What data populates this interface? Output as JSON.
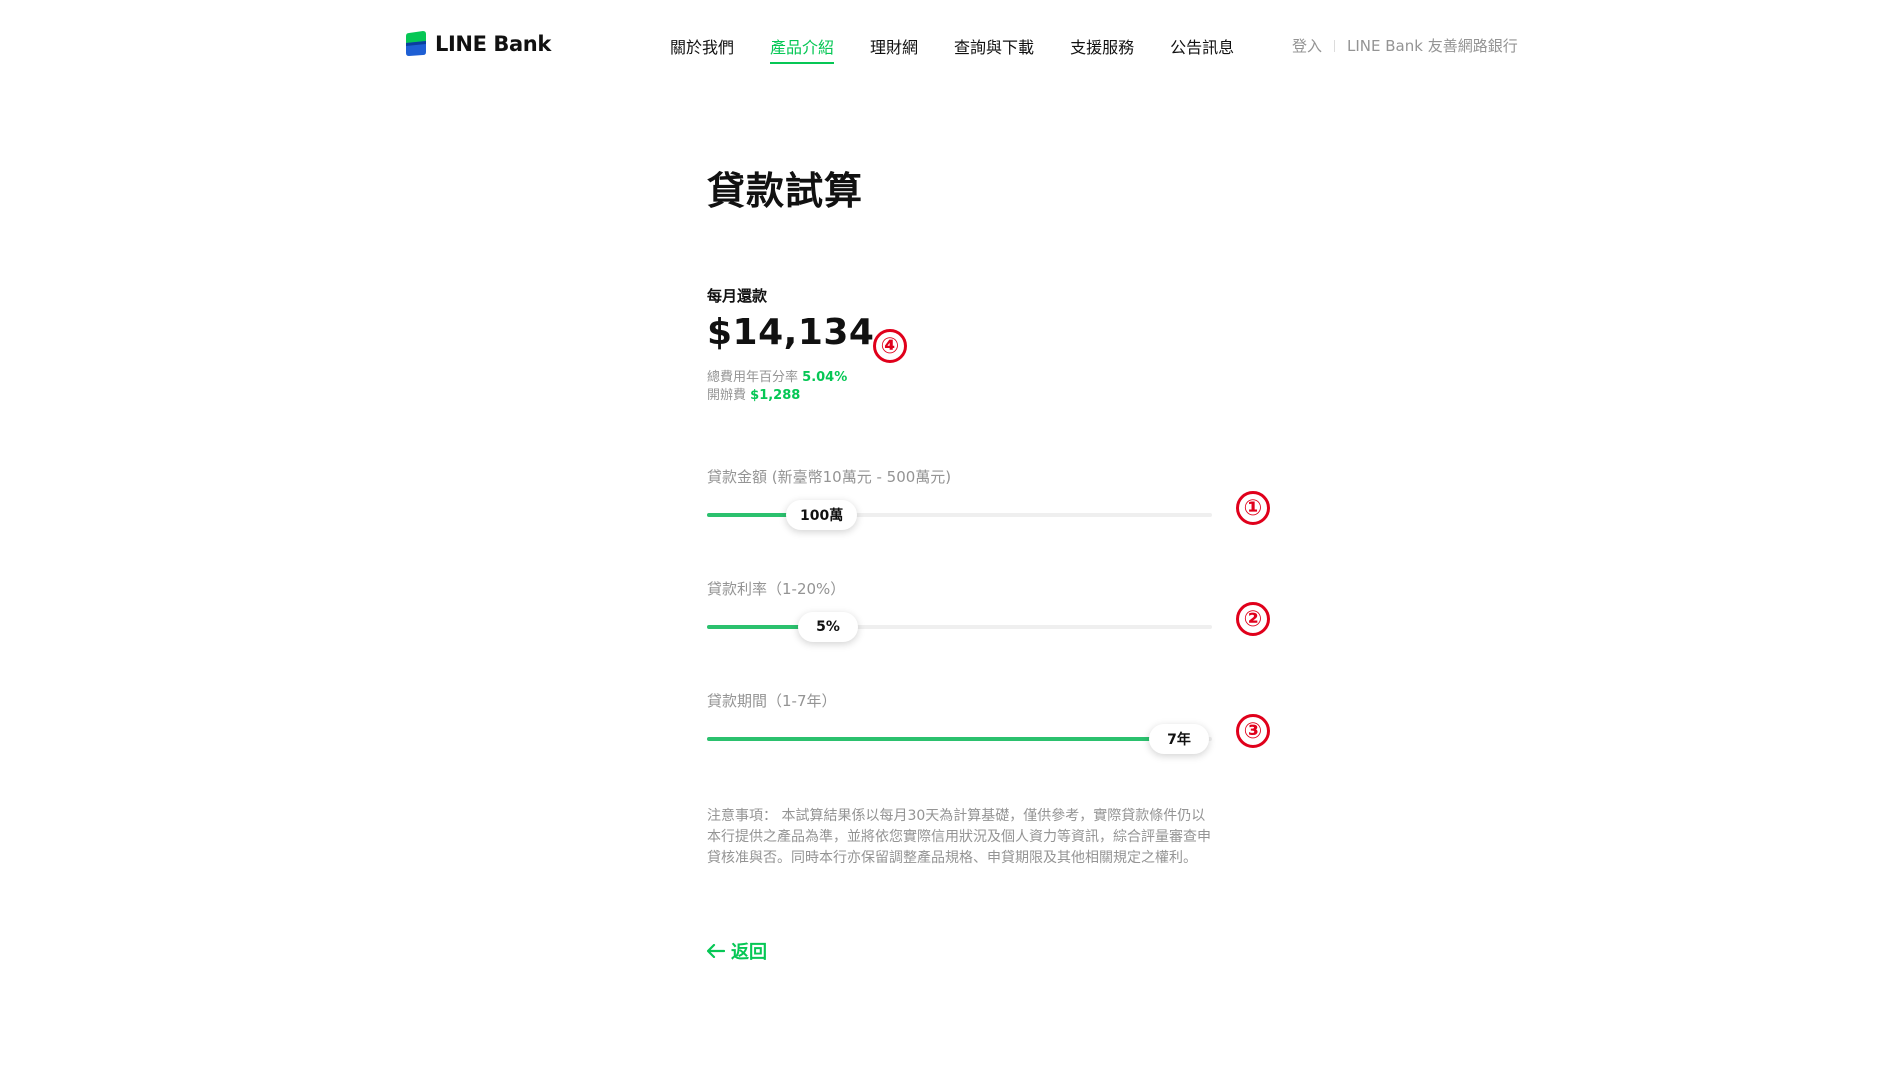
{
  "header": {
    "logo_text": "LINE Bank",
    "nav": [
      {
        "label": "關於我們",
        "active": false
      },
      {
        "label": "產品介紹",
        "active": true
      },
      {
        "label": "理財網",
        "active": false
      },
      {
        "label": "查詢與下載",
        "active": false
      },
      {
        "label": "支援服務",
        "active": false
      },
      {
        "label": "公告訊息",
        "active": false
      }
    ],
    "login_label": "登入",
    "friendly_bank_label": "LINE Bank 友善網路銀行"
  },
  "page": {
    "title": "貸款試算"
  },
  "result": {
    "monthly_label": "每月還款",
    "monthly_amount": "$14,134",
    "apr_label": "總費用年百分率",
    "apr_value": "5.04%",
    "fee_label": "開辦費",
    "fee_value": "$1,288"
  },
  "sliders": {
    "amount": {
      "label": "貸款金額 (新臺幣10萬元 - 500萬元)",
      "value_text": "100萬",
      "min": 10,
      "max": 500,
      "value": 100
    },
    "rate": {
      "label": "貸款利率（1-20%）",
      "value_text": "5%",
      "min": 1,
      "max": 20,
      "value": 5
    },
    "term": {
      "label": "貸款期間（1-7年）",
      "value_text": "7年",
      "min": 1,
      "max": 7,
      "value": 7
    }
  },
  "annotations": {
    "n1": "①",
    "n2": "②",
    "n3": "③",
    "n4": "④"
  },
  "notice": "注意事項： 本試算結果係以每月30天為計算基礎，僅供參考，實際貸款條件仍以本行提供之產品為準，並將依您實際信用狀況及個人資力等資訊，綜合評量審查申貸核准與否。同時本行亦保留調整產品規格、申貸期限及其他相關規定之權利。",
  "back_label": "返回",
  "colors": {
    "brand_green": "#06c755",
    "slider_fill": "#2bc16e",
    "annotation_red": "#e0001b"
  },
  "icons": {
    "logo": "line-bank-logo-icon",
    "back": "arrow-left-icon"
  }
}
